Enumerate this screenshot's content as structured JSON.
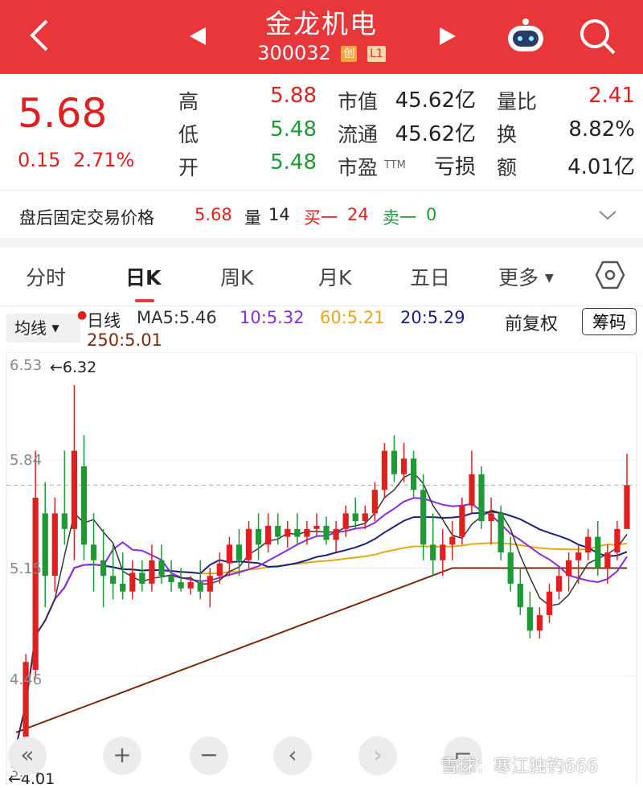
{
  "header": {
    "title": "金龙机电",
    "code": "300032",
    "tag_chuang": "创",
    "tag_level": "L1"
  },
  "quote": {
    "price": "5.68",
    "change": "0.15",
    "change_pct": "2.71%",
    "high_label": "高",
    "high": "5.88",
    "low_label": "低",
    "low": "5.48",
    "open_label": "开",
    "open": "5.48",
    "mcap_label": "市值",
    "mcap": "45.62亿",
    "float_label": "流通",
    "float": "45.62亿",
    "pe_label": "市盈",
    "pe_suffix": "TTM",
    "pe": "亏损",
    "vr_label": "量比",
    "vr": "2.41",
    "turnover_label": "换",
    "turnover": "8.82%",
    "amount_label": "额",
    "amount": "4.01亿"
  },
  "after_hours": {
    "label": "盘后固定交易价格",
    "price": "5.68",
    "vol_label": "量",
    "vol": "14",
    "buy_label": "买一",
    "buy": "24",
    "sell_label": "卖一",
    "sell": "0"
  },
  "tabs": [
    "分时",
    "日K",
    "周K",
    "月K",
    "五日",
    "更多"
  ],
  "chart_controls": {
    "ma_button": "均线",
    "period": "日线",
    "ma5": "MA5:5.46",
    "ma10": "10:5.32",
    "ma60": "60:5.21",
    "ma20": "20:5.29",
    "ma250": "250:5.01",
    "adjust": "前复权",
    "chips": "筹码"
  },
  "colors": {
    "header_bg": "#e8373a",
    "up": "#e02020",
    "down": "#1d9a36",
    "ma5": "#333333",
    "ma10": "#8a2be2",
    "ma20": "#1a237e",
    "ma60": "#e6a817",
    "ma250": "#7b2a0e"
  },
  "chart_data": {
    "type": "candlestick",
    "y_ticks": [
      "6.53",
      "5.84",
      "5.15",
      "4.46",
      "3.77"
    ],
    "ylim": [
      3.77,
      6.53
    ],
    "high_marker": "←6.32",
    "low_marker": "←4.01",
    "last_close_dashed": 5.68,
    "ohlc": [
      [
        3.9,
        4.05,
        3.85,
        4.01
      ],
      [
        4.0,
        4.6,
        3.95,
        4.55
      ],
      [
        4.5,
        5.9,
        4.45,
        5.6
      ],
      [
        5.5,
        5.7,
        4.9,
        5.1
      ],
      [
        5.1,
        5.6,
        5.0,
        5.5
      ],
      [
        5.5,
        5.9,
        5.3,
        5.4
      ],
      [
        5.4,
        6.32,
        5.2,
        5.9
      ],
      [
        5.8,
        6.0,
        5.2,
        5.3
      ],
      [
        5.3,
        5.5,
        5.0,
        5.2
      ],
      [
        5.2,
        5.4,
        4.9,
        5.1
      ],
      [
        5.1,
        5.3,
        4.95,
        5.05
      ],
      [
        5.05,
        5.25,
        4.95,
        5.0
      ],
      [
        5.0,
        5.2,
        4.95,
        5.12
      ],
      [
        5.12,
        5.2,
        5.0,
        5.05
      ],
      [
        5.05,
        5.3,
        5.0,
        5.2
      ],
      [
        5.2,
        5.3,
        5.05,
        5.1
      ],
      [
        5.1,
        5.2,
        5.0,
        5.06
      ],
      [
        5.06,
        5.15,
        5.0,
        5.02
      ],
      [
        5.02,
        5.1,
        4.98,
        5.06
      ],
      [
        5.06,
        5.2,
        4.95,
        5.0
      ],
      [
        5.0,
        5.15,
        4.9,
        5.1
      ],
      [
        5.1,
        5.25,
        5.05,
        5.18
      ],
      [
        5.18,
        5.35,
        5.1,
        5.3
      ],
      [
        5.3,
        5.4,
        5.1,
        5.2
      ],
      [
        5.2,
        5.45,
        5.15,
        5.4
      ],
      [
        5.4,
        5.5,
        5.2,
        5.3
      ],
      [
        5.3,
        5.5,
        5.25,
        5.42
      ],
      [
        5.42,
        5.5,
        5.3,
        5.35
      ],
      [
        5.35,
        5.45,
        5.28,
        5.4
      ],
      [
        5.4,
        5.5,
        5.3,
        5.35
      ],
      [
        5.35,
        5.45,
        5.3,
        5.4
      ],
      [
        5.4,
        5.5,
        5.35,
        5.42
      ],
      [
        5.42,
        5.48,
        5.3,
        5.33
      ],
      [
        5.33,
        5.45,
        5.25,
        5.4
      ],
      [
        5.4,
        5.55,
        5.35,
        5.5
      ],
      [
        5.5,
        5.6,
        5.4,
        5.45
      ],
      [
        5.45,
        5.55,
        5.4,
        5.5
      ],
      [
        5.5,
        5.7,
        5.45,
        5.65
      ],
      [
        5.65,
        5.95,
        5.6,
        5.9
      ],
      [
        5.9,
        6.0,
        5.7,
        5.75
      ],
      [
        5.75,
        5.95,
        5.7,
        5.85
      ],
      [
        5.85,
        5.9,
        5.6,
        5.65
      ],
      [
        5.65,
        5.75,
        5.2,
        5.3
      ],
      [
        5.3,
        5.5,
        5.1,
        5.2
      ],
      [
        5.2,
        5.4,
        5.1,
        5.3
      ],
      [
        5.3,
        5.45,
        5.2,
        5.35
      ],
      [
        5.35,
        5.6,
        5.3,
        5.55
      ],
      [
        5.55,
        5.9,
        5.5,
        5.75
      ],
      [
        5.75,
        5.8,
        5.4,
        5.45
      ],
      [
        5.45,
        5.6,
        5.3,
        5.5
      ],
      [
        5.5,
        5.55,
        5.2,
        5.25
      ],
      [
        5.25,
        5.35,
        5.0,
        5.05
      ],
      [
        5.05,
        5.15,
        4.85,
        4.9
      ],
      [
        4.9,
        5.0,
        4.7,
        4.75
      ],
      [
        4.75,
        4.9,
        4.7,
        4.85
      ],
      [
        4.85,
        5.05,
        4.8,
        5.0
      ],
      [
        5.0,
        5.15,
        4.95,
        5.1
      ],
      [
        5.1,
        5.25,
        5.0,
        5.2
      ],
      [
        5.2,
        5.3,
        5.05,
        5.25
      ],
      [
        5.25,
        5.4,
        5.2,
        5.35
      ],
      [
        5.35,
        5.45,
        5.1,
        5.15
      ],
      [
        5.15,
        5.3,
        5.05,
        5.25
      ],
      [
        5.25,
        5.45,
        5.2,
        5.4
      ],
      [
        5.4,
        5.88,
        5.48,
        5.68
      ]
    ]
  },
  "bottom_buttons": [
    "«",
    "+",
    "−",
    "‹",
    "›",
    "⌐"
  ],
  "watermark": "雪球：寒江独钓666"
}
